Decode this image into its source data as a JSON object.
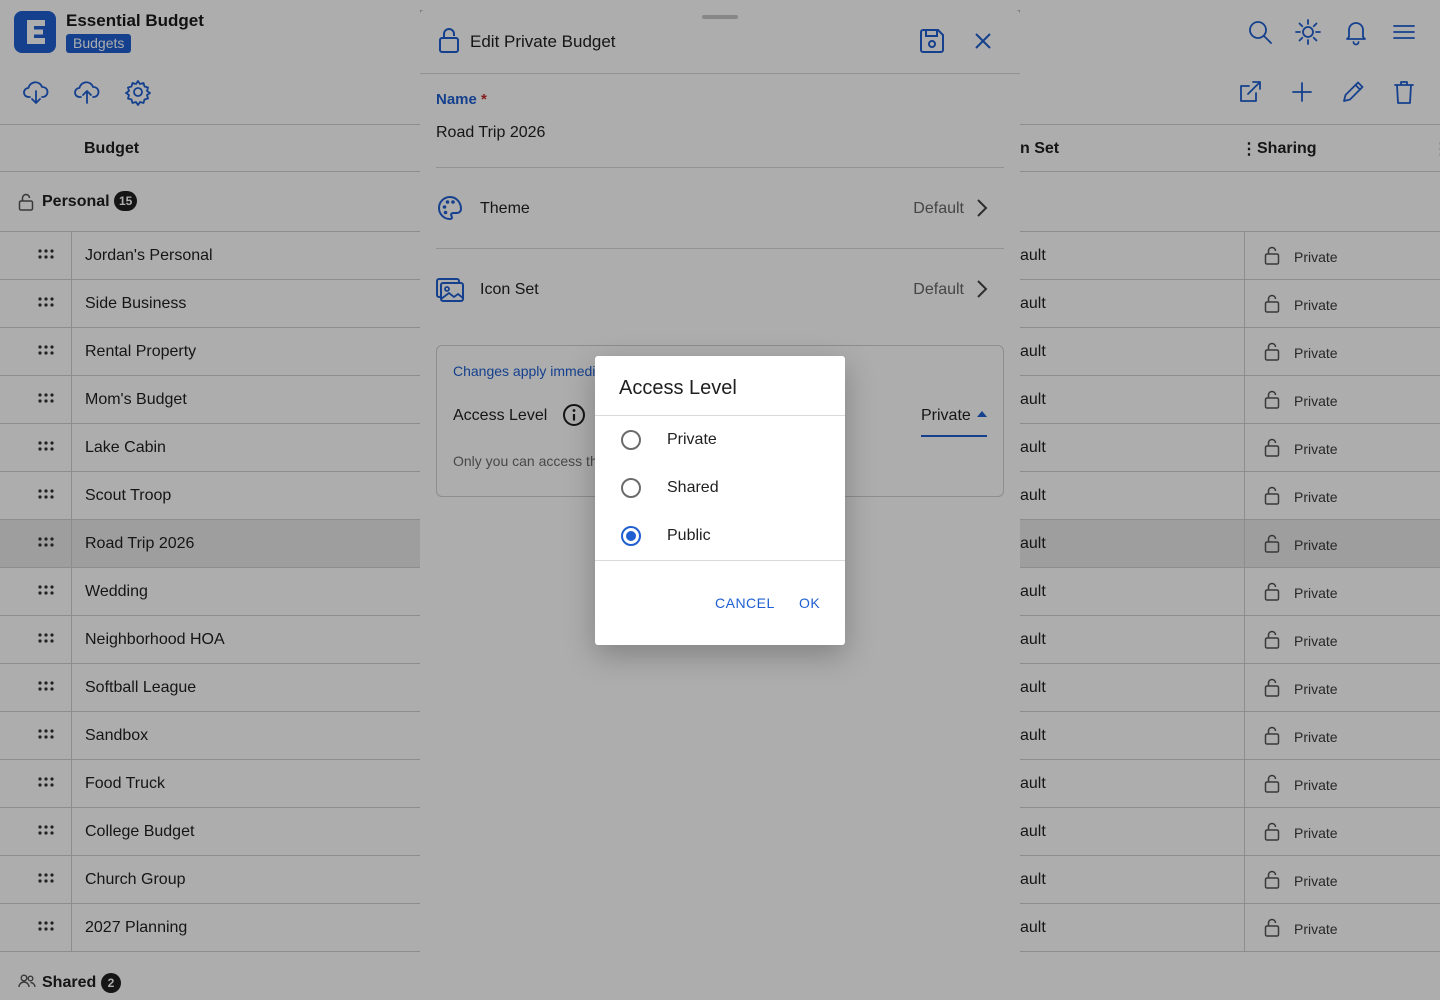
{
  "app": {
    "title": "Essential Budget",
    "section_badge": "Budgets",
    "accent_color": "#1f5fd1"
  },
  "toolbar_left": [
    "cloud-download-icon",
    "cloud-upload-icon",
    "settings-icon"
  ],
  "toolbar_right": [
    "open-external-icon",
    "add-icon",
    "edit-icon",
    "delete-icon"
  ],
  "top_icons": [
    "search-icon",
    "brightness-icon",
    "notifications-icon",
    "menu-icon"
  ],
  "table": {
    "col_budget": "Budget",
    "col_iconset": "n Set",
    "col_sharing": "Sharing"
  },
  "groups": {
    "personal": {
      "label": "Personal",
      "count": "15"
    },
    "shared": {
      "label": "Shared",
      "count": "2"
    }
  },
  "rows": [
    {
      "name": "Jordan's Personal",
      "iconset": "ault",
      "sharing": "Private"
    },
    {
      "name": "Side Business",
      "iconset": "ault",
      "sharing": "Private"
    },
    {
      "name": "Rental Property",
      "iconset": "ault",
      "sharing": "Private"
    },
    {
      "name": "Mom's Budget",
      "iconset": "ault",
      "sharing": "Private"
    },
    {
      "name": "Lake Cabin",
      "iconset": "ault",
      "sharing": "Private"
    },
    {
      "name": "Scout Troop",
      "iconset": "ault",
      "sharing": "Private"
    },
    {
      "name": "Road Trip 2026",
      "iconset": "ault",
      "sharing": "Private",
      "selected": true
    },
    {
      "name": "Wedding",
      "iconset": "ault",
      "sharing": "Private"
    },
    {
      "name": "Neighborhood HOA",
      "iconset": "ault",
      "sharing": "Private"
    },
    {
      "name": "Softball League",
      "iconset": "ault",
      "sharing": "Private"
    },
    {
      "name": "Sandbox",
      "iconset": "ault",
      "sharing": "Private"
    },
    {
      "name": "Food Truck",
      "iconset": "ault",
      "sharing": "Private"
    },
    {
      "name": "College Budget",
      "iconset": "ault",
      "sharing": "Private"
    },
    {
      "name": "Church Group",
      "iconset": "ault",
      "sharing": "Private"
    },
    {
      "name": "2027 Planning",
      "iconset": "ault",
      "sharing": "Private"
    }
  ],
  "sheet": {
    "title": "Edit Private Budget",
    "name_label": "Name",
    "required_mark": "*",
    "name_value": "Road Trip 2026",
    "theme_label": "Theme",
    "theme_value": "Default",
    "iconset_label": "Icon Set",
    "iconset_value": "Default",
    "access_note": "Changes apply immedi",
    "access_label": "Access Level",
    "access_value": "Private",
    "access_help": "Only you can access th"
  },
  "dialog": {
    "title": "Access Level",
    "options": [
      {
        "label": "Private",
        "selected": false
      },
      {
        "label": "Shared",
        "selected": false
      },
      {
        "label": "Public",
        "selected": true
      }
    ],
    "cancel": "CANCEL",
    "ok": "OK"
  }
}
